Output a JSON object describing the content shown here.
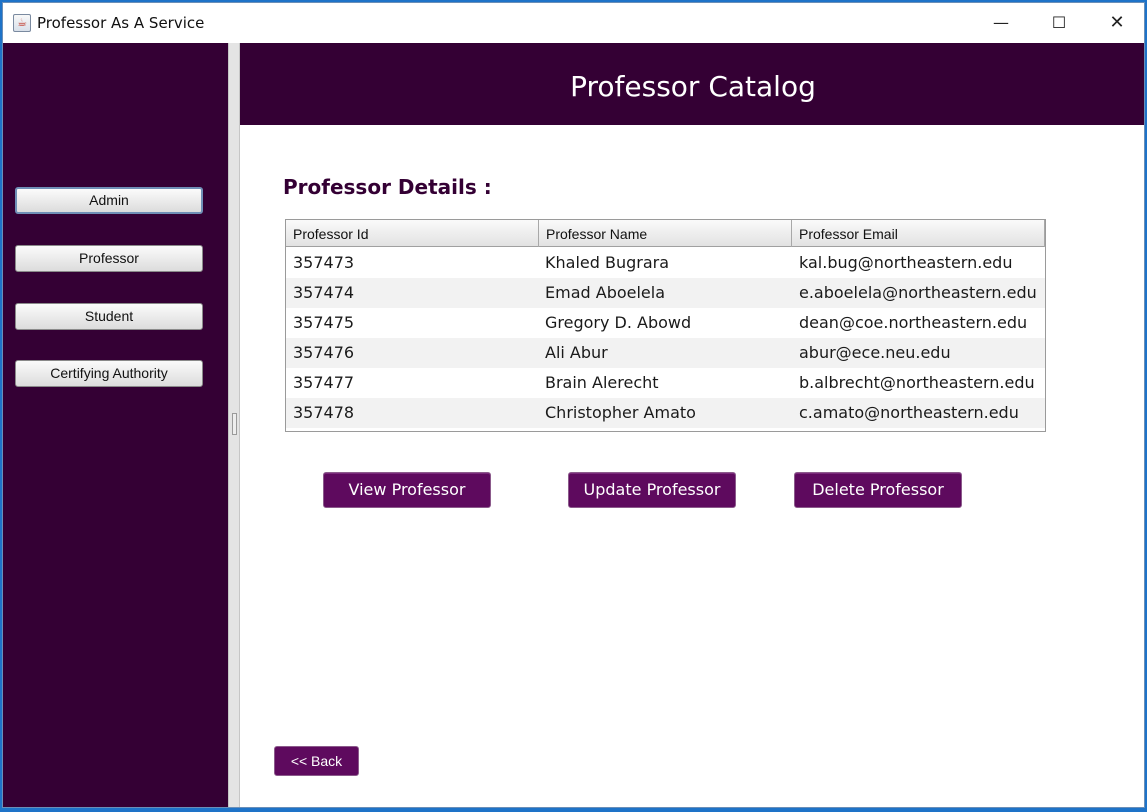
{
  "window": {
    "title": "Professor As A Service",
    "controls": {
      "minimize": "—",
      "maximize": "☐",
      "close": "✕"
    }
  },
  "sidebar": {
    "buttons": [
      {
        "label": "Admin",
        "active": true
      },
      {
        "label": "Professor",
        "active": false
      },
      {
        "label": "Student",
        "active": false
      },
      {
        "label": "Certifying Authority",
        "active": false
      }
    ]
  },
  "header": {
    "title": "Professor Catalog"
  },
  "main": {
    "section_label": "Professor Details :",
    "table": {
      "columns": [
        "Professor Id",
        "Professor Name",
        "Professor Email"
      ],
      "rows": [
        {
          "id": "357473",
          "name": "Khaled Bugrara",
          "email": "kal.bug@northeastern.edu"
        },
        {
          "id": "357474",
          "name": "Emad Aboelela",
          "email": "e.aboelela@northeastern.edu"
        },
        {
          "id": "357475",
          "name": "Gregory D. Abowd",
          "email": "dean@coe.northeastern.edu"
        },
        {
          "id": "357476",
          "name": "Ali Abur",
          "email": "abur@ece.neu.edu"
        },
        {
          "id": "357477",
          "name": "Brain Alerecht",
          "email": "b.albrecht@northeastern.edu"
        },
        {
          "id": "357478",
          "name": "Christopher Amato",
          "email": "c.amato@northeastern.edu"
        }
      ]
    },
    "actions": {
      "view": "View Professor",
      "update": "Update Professor",
      "delete": "Delete Professor"
    },
    "back": "<< Back"
  },
  "colors": {
    "brand_dark": "#340034",
    "button_purple": "#5e0a5e",
    "taskbar_blue": "#1e73c8"
  },
  "icons": {
    "app": "java-cup-icon"
  }
}
